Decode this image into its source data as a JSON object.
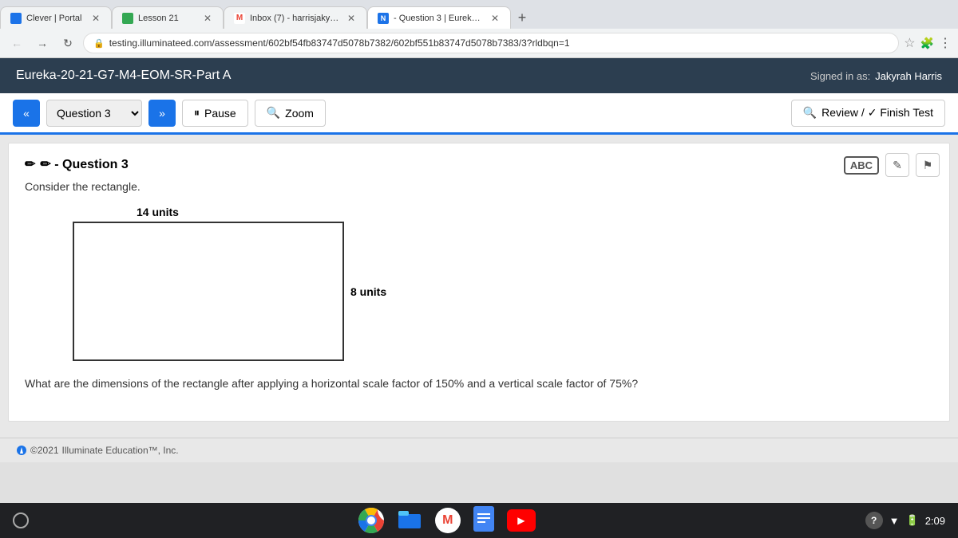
{
  "browser": {
    "tabs": [
      {
        "id": "clever",
        "icon_color": "#1c73e8",
        "label": "Clever | Portal",
        "active": false,
        "icon_letter": "C"
      },
      {
        "id": "lesson",
        "icon_color": "#34a853",
        "label": "Lesson 21",
        "active": false,
        "icon_letter": "A"
      },
      {
        "id": "gmail",
        "icon_color": "#ea4335",
        "label": "Inbox (7) - harrisjakyrah5@g...",
        "active": false,
        "icon_letter": "M"
      },
      {
        "id": "question",
        "icon_color": "#1c73e8",
        "label": "- Question 3 | Eureka-20-21-...",
        "active": true,
        "icon_letter": "N"
      }
    ],
    "url": "testing.illuminateed.com/assessment/602bf54fb83747d5078b7382/602bf551b83747d5078b7383/3?rldbqn=1"
  },
  "app_header": {
    "title": "Eureka-20-21-G7-M4-EOM-SR-Part A",
    "signed_in_label": "Signed in as:",
    "user_name": "Jakyrah Harris"
  },
  "toolbar": {
    "prev_btn": "«",
    "question_label": "Question 3",
    "next_btn": "»",
    "pause_label": "Pause",
    "zoom_label": "Zoom",
    "review_label": "Review / ✓ Finish Test",
    "pause_icon": "⏸",
    "zoom_icon": "🔍"
  },
  "question": {
    "header": "✏ - Question 3",
    "intro": "Consider the rectangle.",
    "dim_top": "14 units",
    "dim_right": "8 units",
    "question_text": "What are the dimensions of the rectangle after applying a horizontal scale factor of 150% and a vertical scale factor of 75%?"
  },
  "card_toolbar": {
    "abc_label": "ABC",
    "edit_icon": "✎",
    "flag_icon": "⚑"
  },
  "footer": {
    "copyright": "©2021",
    "company": "Illuminate Education™, Inc."
  },
  "taskbar": {
    "time": "2:09"
  }
}
